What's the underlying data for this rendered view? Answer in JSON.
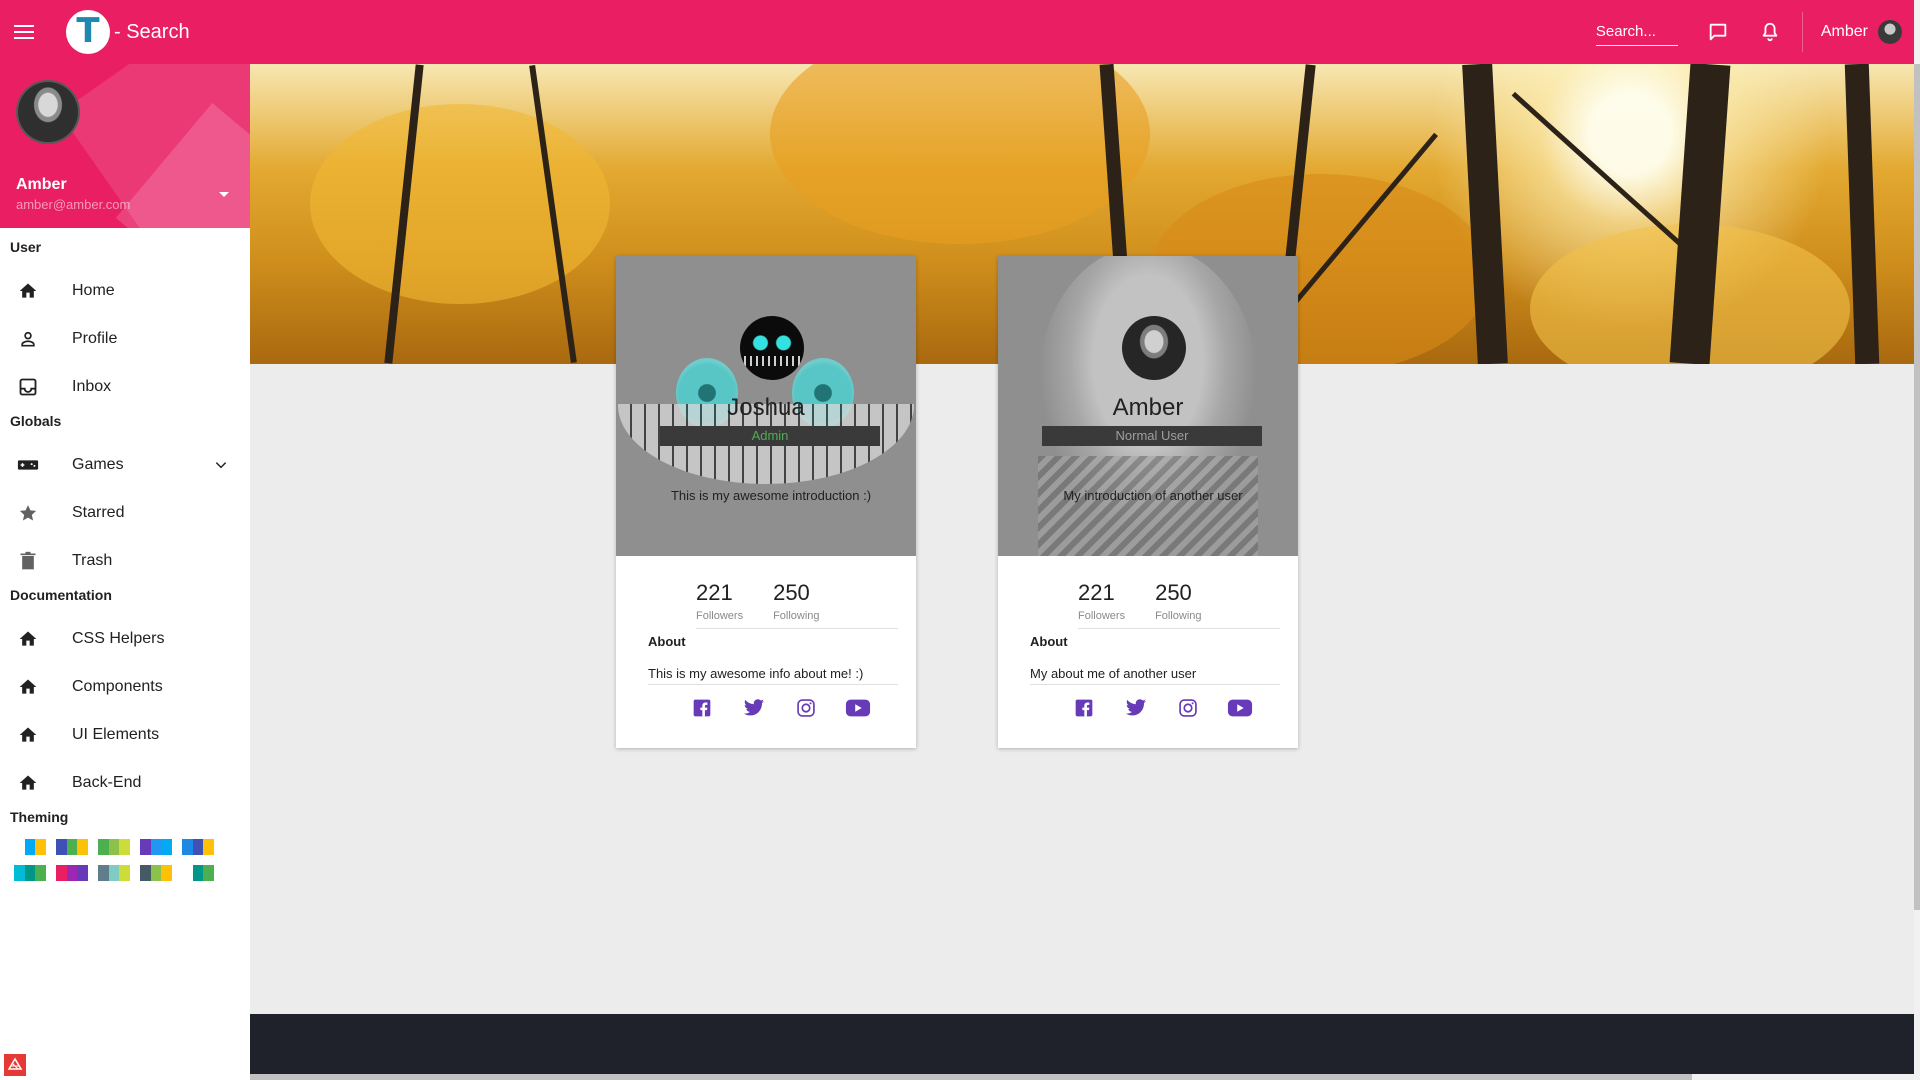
{
  "app": {
    "title": "- Search"
  },
  "header": {
    "search_placeholder": "Search...",
    "user_name": "Amber"
  },
  "sidebar": {
    "profile": {
      "name": "Amber",
      "email": "amber@amber.com"
    },
    "sections": {
      "user": "User",
      "globals": "Globals",
      "documentation": "Documentation",
      "theming": "Theming"
    },
    "user_items": [
      {
        "label": "Home",
        "icon": "home-icon"
      },
      {
        "label": "Profile",
        "icon": "person-icon"
      },
      {
        "label": "Inbox",
        "icon": "inbox-icon"
      }
    ],
    "global_items": [
      {
        "label": "Games",
        "icon": "gamepad-icon"
      },
      {
        "label": "Starred",
        "icon": "star-icon"
      },
      {
        "label": "Trash",
        "icon": "trash-icon"
      }
    ],
    "doc_items": [
      {
        "label": "CSS Helpers",
        "icon": "home-icon"
      },
      {
        "label": "Components",
        "icon": "home-icon"
      },
      {
        "label": "UI Elements",
        "icon": "home-icon"
      },
      {
        "label": "Back-End",
        "icon": "home-icon"
      }
    ],
    "theme_swatches": [
      [
        "#ffffff",
        "#03a9f4",
        "#ffc107"
      ],
      [
        "#3f51b5",
        "#4caf50",
        "#ffc107"
      ],
      [
        "#4caf50",
        "#8bc34a",
        "#cddc39"
      ],
      [
        "#673ab7",
        "#2196f3",
        "#03a9f4"
      ],
      [
        "#1e88e5",
        "#3f51b5",
        "#ffc107"
      ],
      [
        "#00bcd4",
        "#009688",
        "#4caf50"
      ],
      [
        "#e91e63",
        "#9c27b0",
        "#673ab7"
      ],
      [
        "#607d8b",
        "#80cbc4",
        "#cddc39"
      ],
      [
        "#455a64",
        "#8bc34a",
        "#ffc107"
      ],
      [
        "#ffffff",
        "#009688",
        "#4caf50"
      ]
    ]
  },
  "cards": [
    {
      "name": "Joshua",
      "role": "Admin",
      "role_color": "#4caf50",
      "intro": "This is my awesome introduction :)",
      "followers": "221",
      "followers_label": "Followers",
      "following": "250",
      "following_label": "Following",
      "about_title": "About",
      "about_text": "This is my awesome info about me! :)"
    },
    {
      "name": "Amber",
      "role": "Normal User",
      "role_color": "#9e9e9e",
      "intro": "My introduction of another user",
      "followers": "221",
      "followers_label": "Followers",
      "following": "250",
      "following_label": "Following",
      "about_title": "About",
      "about_text": "My about me of another user"
    }
  ],
  "colors": {
    "primary": "#e91e63",
    "social": "#673ab7",
    "footer": "#1f222a",
    "content_bg": "#ececec"
  }
}
